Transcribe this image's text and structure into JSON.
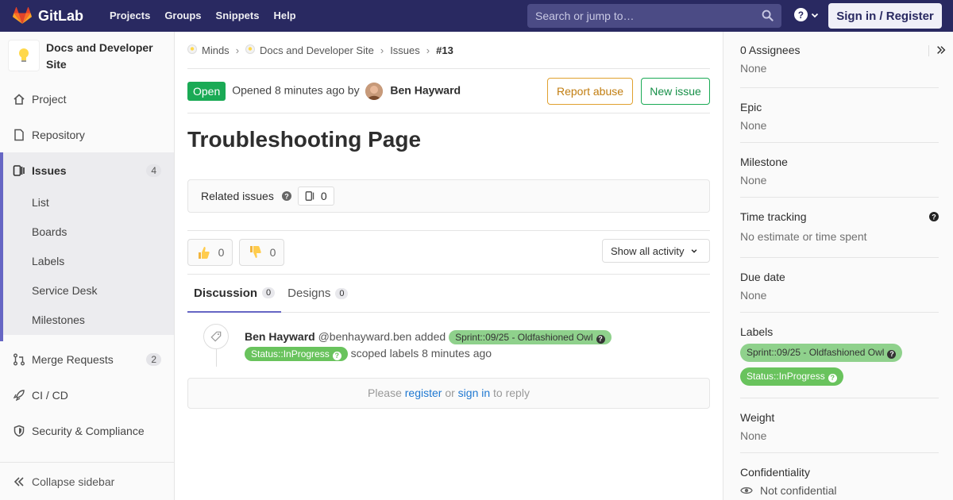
{
  "nav": {
    "brand": "GitLab",
    "links": [
      "Projects",
      "Groups",
      "Snippets",
      "Help"
    ],
    "search_placeholder": "Search or jump to…",
    "signin": "Sign in / Register"
  },
  "colors": {
    "navbar": "#292961",
    "accent": "#6666c4",
    "open_green": "#1aaa55"
  },
  "sidebar": {
    "project_name": "Docs and Developer Site",
    "items": [
      {
        "label": "Project",
        "icon": "home-icon"
      },
      {
        "label": "Repository",
        "icon": "doc-icon"
      },
      {
        "label": "Issues",
        "icon": "issues-icon",
        "count": "4"
      },
      {
        "label": "Merge Requests",
        "icon": "merge-request-icon",
        "count": "2"
      },
      {
        "label": "CI / CD",
        "icon": "rocket-icon"
      },
      {
        "label": "Security & Compliance",
        "icon": "shield-icon"
      }
    ],
    "issues_sub": [
      "List",
      "Boards",
      "Labels",
      "Service Desk",
      "Milestones"
    ],
    "collapse": "Collapse sidebar"
  },
  "breadcrumb": [
    "Minds",
    "Docs and Developer Site",
    "Issues",
    "#13"
  ],
  "issue": {
    "status": "Open",
    "opened_text": "Opened 8 minutes ago by",
    "author": "Ben Hayward",
    "report_abuse": "Report abuse",
    "new_issue": "New issue",
    "title": "Troubleshooting Page",
    "related_label": "Related issues",
    "related_count": "0",
    "thumbs_up": "0",
    "thumbs_down": "0",
    "activity_filter": "Show all activity"
  },
  "tabs": [
    {
      "label": "Discussion",
      "count": "0"
    },
    {
      "label": "Designs",
      "count": "0"
    }
  ],
  "note": {
    "author": "Ben Hayward",
    "handle": "@benhayward.ben",
    "action": "added",
    "label_sprint": "Sprint::09/25 - Oldfashioned Owl",
    "label_status": "Status::InProgress",
    "suffix": "scoped labels 8 minutes ago"
  },
  "reply": {
    "please": "Please",
    "register": "register",
    "or": "or",
    "signin": "sign in",
    "to_reply": "to reply"
  },
  "right_sidebar": {
    "assignees_title": "0 Assignees",
    "assignees_value": "None",
    "epic_title": "Epic",
    "epic_value": "None",
    "milestone_title": "Milestone",
    "milestone_value": "None",
    "time_title": "Time tracking",
    "time_value": "No estimate or time spent",
    "due_title": "Due date",
    "due_value": "None",
    "labels_title": "Labels",
    "label_sprint": "Sprint::09/25 - Oldfashioned Owl",
    "label_status": "Status::InProgress",
    "weight_title": "Weight",
    "weight_value": "None",
    "confidentiality_title": "Confidentiality",
    "confidentiality_value": "Not confidential"
  }
}
